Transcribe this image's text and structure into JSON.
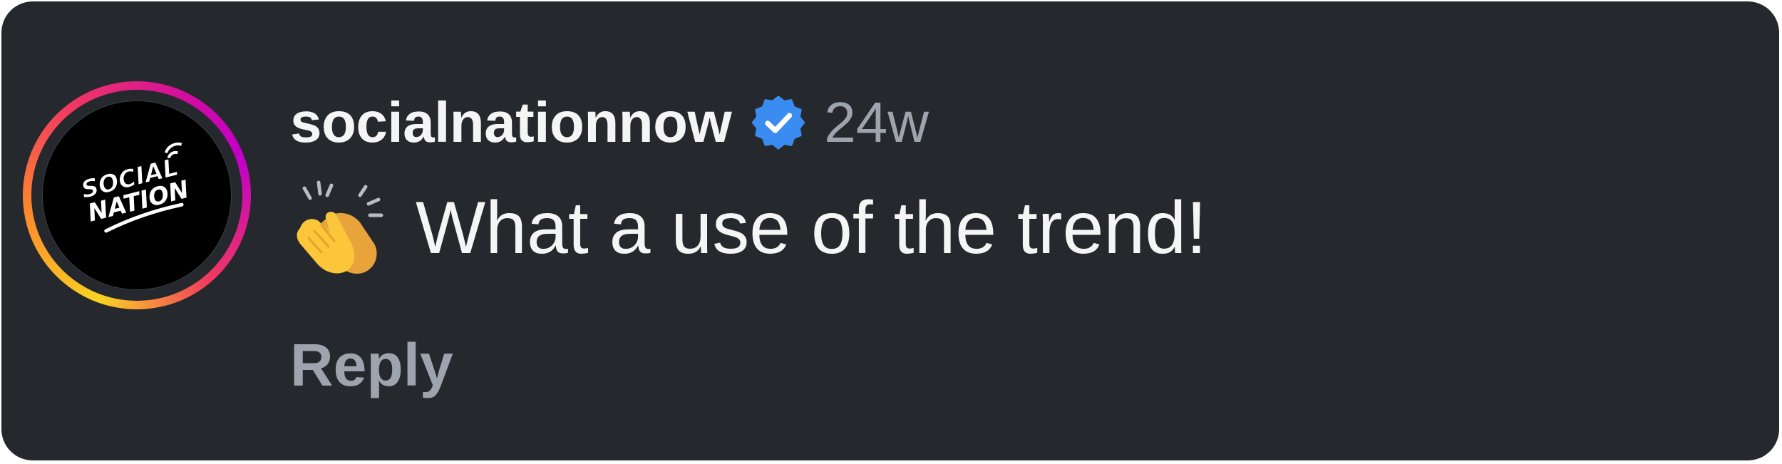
{
  "comment": {
    "avatar": {
      "logo_lines": [
        "SOCIAL",
        "NATION"
      ],
      "ring_colors": [
        "#f9d423",
        "#fc8a2c",
        "#f23a5e",
        "#d10ba3",
        "#c100c8"
      ]
    },
    "username": "socialnationnow",
    "verified_icon": "verified-badge-icon",
    "verified_color": "#3b8cf0",
    "timestamp": "24w",
    "emoji": "clapping-hands-icon",
    "text": "What a use of the trend!",
    "reply_label": "Reply"
  },
  "colors": {
    "background": "#25282d",
    "primary_text": "#f5f5f5",
    "secondary_text": "#9ea4ad"
  }
}
